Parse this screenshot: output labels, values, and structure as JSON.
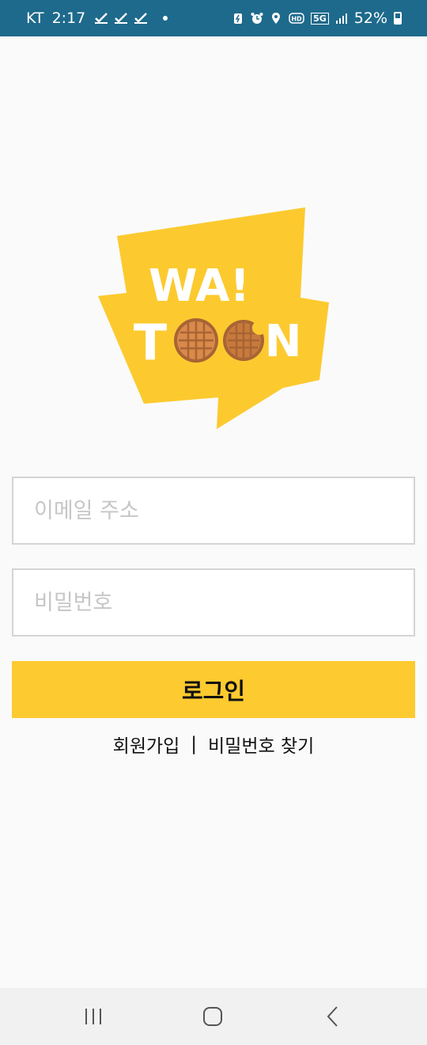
{
  "status_bar": {
    "carrier": "KT",
    "time": "2:17",
    "network": "5G",
    "battery": "52%",
    "background_color": "#1e6a8c"
  },
  "logo": {
    "line1": "WA!",
    "line2_left": "T",
    "line2_right": "N",
    "color": "#fcca2f"
  },
  "form": {
    "email_placeholder": "이메일 주소",
    "password_placeholder": "비밀번호",
    "login_label": "로그인",
    "login_color": "#fdca30"
  },
  "links": {
    "signup": "회원가입",
    "separator": "|",
    "find_password": "비밀번호 찾기"
  },
  "nav": {
    "recents_icon": "recents-icon",
    "home_icon": "home-icon",
    "back_icon": "back-icon"
  }
}
